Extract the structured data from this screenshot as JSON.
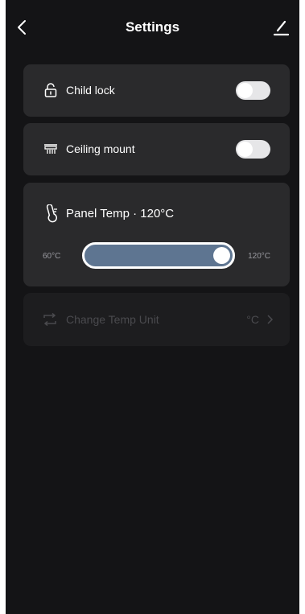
{
  "header": {
    "title": "Settings",
    "back_icon": "chevron-left-icon",
    "edit_icon": "pencil-icon"
  },
  "settings": {
    "child_lock": {
      "label": "Child lock",
      "icon": "lock-icon",
      "enabled": false
    },
    "ceiling_mount": {
      "label": "Ceiling mount",
      "icon": "ceiling-heater-icon",
      "enabled": false
    },
    "panel_temp": {
      "label": "Panel Temp · 120°C",
      "icon": "thermometer-icon",
      "min_label": "60°C",
      "max_label": "120°C",
      "value": 120,
      "min": 60,
      "max": 120
    },
    "temp_unit": {
      "label": "Change Temp Unit",
      "icon": "swap-icon",
      "value": "°C",
      "disabled": true
    }
  },
  "colors": {
    "background": "#141416",
    "card": "#2a2a2c",
    "slider_fill": "#5e7591",
    "disabled_text": "#4a4a4e"
  }
}
